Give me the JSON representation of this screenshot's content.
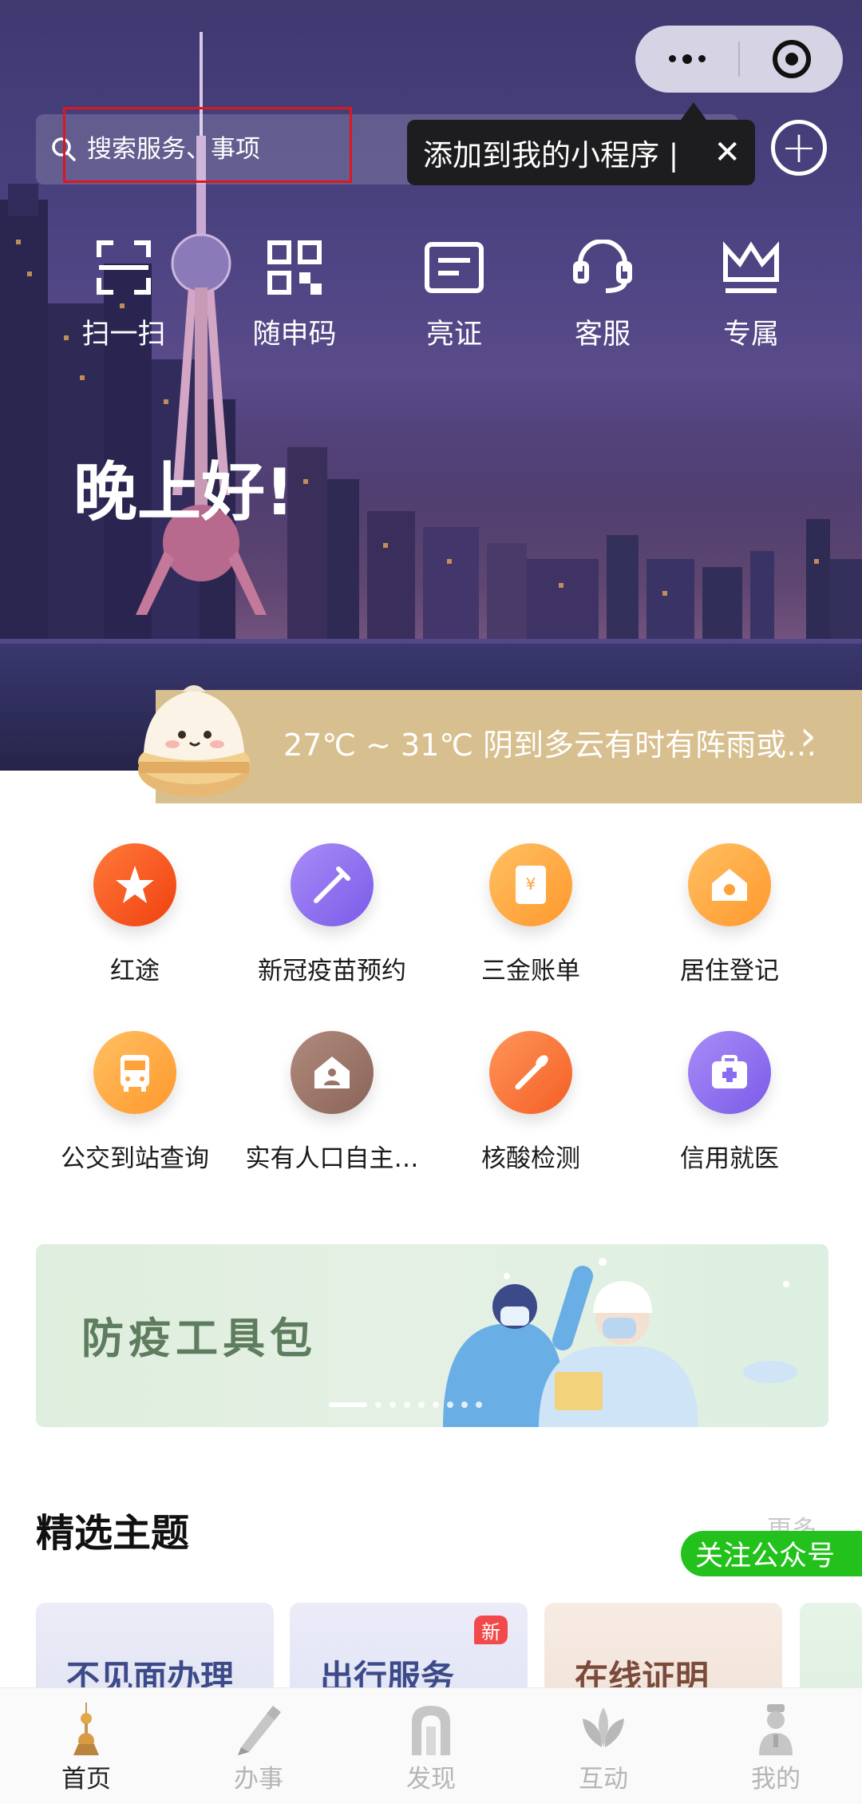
{
  "top_bar": {
    "search_placeholder": "搜索服务、事项",
    "tooltip_text": "添加到我的小程序 |",
    "tooltip_close": "✕",
    "more_icon": "more-dots-icon",
    "close_icon": "record-target-icon",
    "add_icon": "plus-circle-icon"
  },
  "quick_actions": [
    {
      "label": "扫一扫",
      "icon": "scan-icon"
    },
    {
      "label": "随申码",
      "icon": "qr-code-icon"
    },
    {
      "label": "亮证",
      "icon": "id-card-icon"
    },
    {
      "label": "客服",
      "icon": "customer-service-icon"
    },
    {
      "label": "专属",
      "icon": "crown-icon"
    }
  ],
  "greeting": "晚上好!",
  "weather": {
    "text": "27℃ ~ 31℃ 阴到多云有时有阵雨或…",
    "mascot": "xiaolongbao-mascot"
  },
  "services": [
    {
      "label": "红途",
      "icon": "star-flag-icon",
      "color": "#f4511e"
    },
    {
      "label": "新冠疫苗预约",
      "icon": "syringe-icon",
      "color": "#8a6cf0"
    },
    {
      "label": "三金账单",
      "icon": "bill-icon",
      "color": "#ffa23a"
    },
    {
      "label": "居住登记",
      "icon": "house-icon",
      "color": "#ffa23a"
    },
    {
      "label": "公交到站查询",
      "icon": "bus-icon",
      "color": "#ffa23a"
    },
    {
      "label": "实有人口自主…",
      "icon": "home-person-icon",
      "color": "#9a7466"
    },
    {
      "label": "核酸检测",
      "icon": "swab-icon",
      "color": "#f4733a"
    },
    {
      "label": "信用就医",
      "icon": "medical-kit-icon",
      "color": "#8a6cf0"
    }
  ],
  "banner": {
    "title": "防疫工具包"
  },
  "featured": {
    "title": "精选主题",
    "more": "更多",
    "follow_label": "关注公众号",
    "cards": [
      {
        "label": "不见面办理",
        "color": "#3d4a8a"
      },
      {
        "label": "出行服务",
        "color": "#3d4a8a",
        "badge": "新"
      },
      {
        "label": "在线证明",
        "color": "#7a4a3a"
      }
    ]
  },
  "tabs": [
    {
      "label": "首页",
      "icon": "tower-icon",
      "active": true
    },
    {
      "label": "办事",
      "icon": "pen-icon",
      "active": false
    },
    {
      "label": "发现",
      "icon": "arch-icon",
      "active": false
    },
    {
      "label": "互动",
      "icon": "lotus-icon",
      "active": false
    },
    {
      "label": "我的",
      "icon": "user-icon",
      "active": false
    }
  ]
}
